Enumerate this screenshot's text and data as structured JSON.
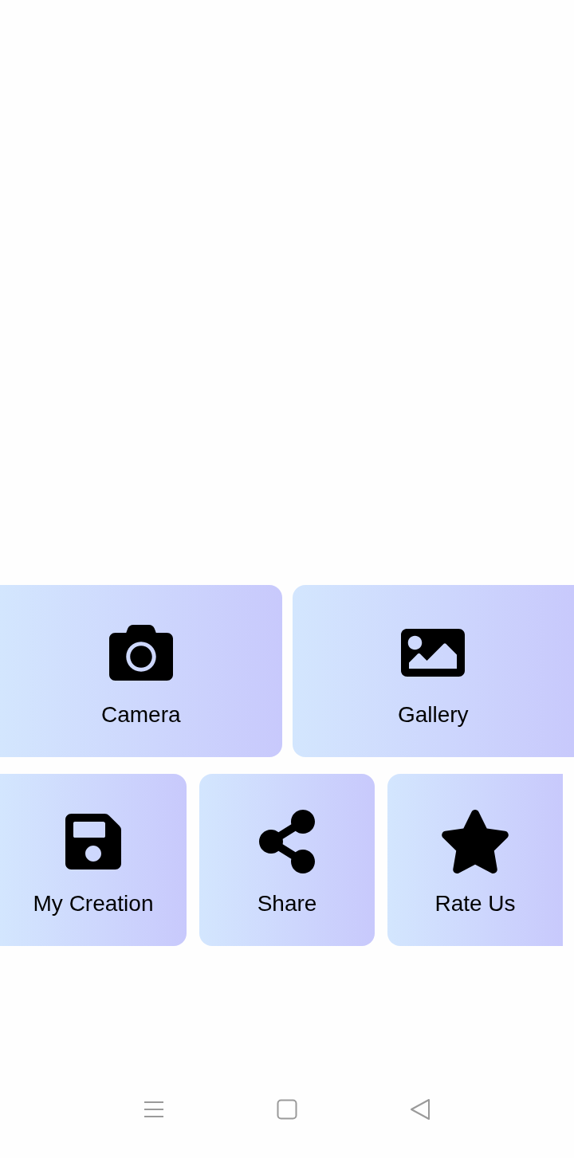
{
  "menu_rows": [
    [
      {
        "label": "Camera"
      },
      {
        "label": "Gallery"
      }
    ],
    [
      {
        "label": "My Creation"
      },
      {
        "label": "Share"
      },
      {
        "label": "Rate Us"
      }
    ]
  ]
}
